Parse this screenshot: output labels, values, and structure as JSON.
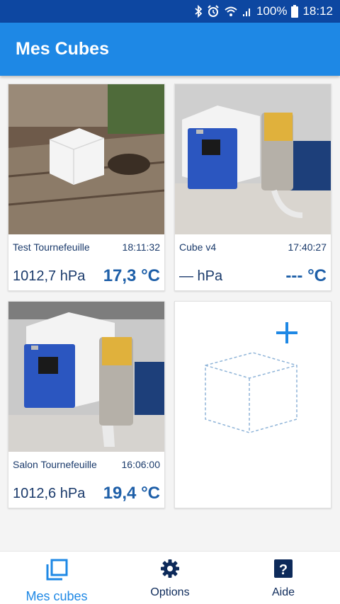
{
  "status_bar": {
    "battery": "100%",
    "time": "18:12"
  },
  "app_bar": {
    "title": "Mes Cubes"
  },
  "cubes": [
    {
      "name": "Test Tournefeuille",
      "time": "18:11:32",
      "pressure": "1012,7 hPa",
      "temperature": "17,3 °C"
    },
    {
      "name": "Cube v4",
      "time": "17:40:27",
      "pressure": "— hPa",
      "temperature": "--- °C"
    },
    {
      "name": "Salon Tournefeuille",
      "time": "16:06:00",
      "pressure": "1012,6 hPa",
      "temperature": "19,4 °C"
    }
  ],
  "add_card": {
    "icon": "plus-icon"
  },
  "bottom_nav": [
    {
      "label": "Mes cubes",
      "icon": "cubes-icon",
      "active": true
    },
    {
      "label": "Options",
      "icon": "gear-icon",
      "active": false
    },
    {
      "label": "Aide",
      "icon": "help-icon",
      "active": false
    }
  ],
  "colors": {
    "primary": "#1e88e5",
    "status_bar": "#0d47a1",
    "text_dark": "#1a3a6b",
    "temperature": "#1e5fa8"
  }
}
